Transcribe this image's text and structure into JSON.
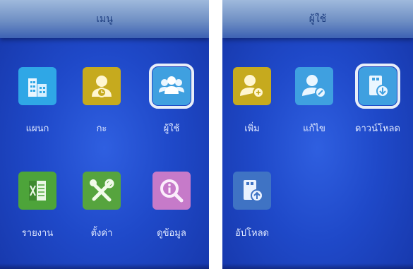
{
  "screens": [
    {
      "title": "เมนู",
      "items": [
        {
          "label": "แผนก",
          "icon": "building-icon",
          "color": "#2fa7e6",
          "selected": false
        },
        {
          "label": "กะ",
          "icon": "shift-person-clock-icon",
          "color": "#c6aa1e",
          "selected": false
        },
        {
          "label": "ผู้ใช้",
          "icon": "users-group-icon",
          "color": "#3fa0e0",
          "selected": true
        },
        {
          "label": "รายงาน",
          "icon": "report-spreadsheet-icon",
          "color": "#4da43a",
          "selected": false
        },
        {
          "label": "ตั้งค่า",
          "icon": "settings-tools-icon",
          "color": "#56a43e",
          "selected": false
        },
        {
          "label": "ดูข้อมูล",
          "icon": "info-magnifier-icon",
          "color": "#c67ac9",
          "selected": false
        }
      ]
    },
    {
      "title": "ผู้ใช้",
      "items": [
        {
          "label": "เพิ่ม",
          "icon": "add-user-icon",
          "color": "#c6aa1e",
          "selected": false
        },
        {
          "label": "แก้ไข",
          "icon": "edit-user-icon",
          "color": "#3fa0e0",
          "selected": false
        },
        {
          "label": "ดาวน์โหลด",
          "icon": "download-icon",
          "color": "#3fa0e0",
          "selected": true
        },
        {
          "label": "อัปโหลด",
          "icon": "upload-usb-icon",
          "color": "#3f73c4",
          "selected": false
        }
      ]
    }
  ]
}
